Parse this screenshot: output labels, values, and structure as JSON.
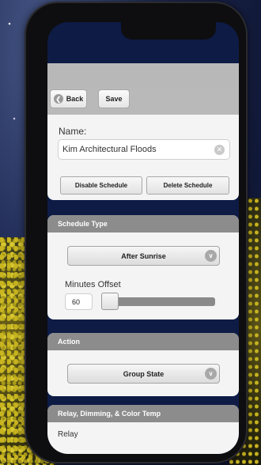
{
  "toolbar": {
    "back_label": "Back",
    "save_label": "Save"
  },
  "form": {
    "name_label": "Name:",
    "name_value": "Kim Architectural Floods",
    "disable_label": "Disable Schedule",
    "delete_label": "Delete Schedule"
  },
  "schedule": {
    "header": "Schedule Type",
    "type_selected": "After Sunrise",
    "offset_label": "Minutes Offset",
    "offset_value": "60",
    "slider_fraction": 0
  },
  "action": {
    "header": "Action",
    "selected": "Group State"
  },
  "relay": {
    "header": "Relay, Dimming, & Color Temp",
    "relay_label": "Relay"
  },
  "icons": {
    "back": "back-arrow-icon",
    "clear": "clear-x-icon",
    "dropdown": "chevron-down-icon"
  },
  "colors": {
    "header_bg": "#8c8c8c",
    "toolbar_bg": "#b9b9b9",
    "panel_bg": "#f4f4f4",
    "screen_bg": "#0d1b45"
  }
}
